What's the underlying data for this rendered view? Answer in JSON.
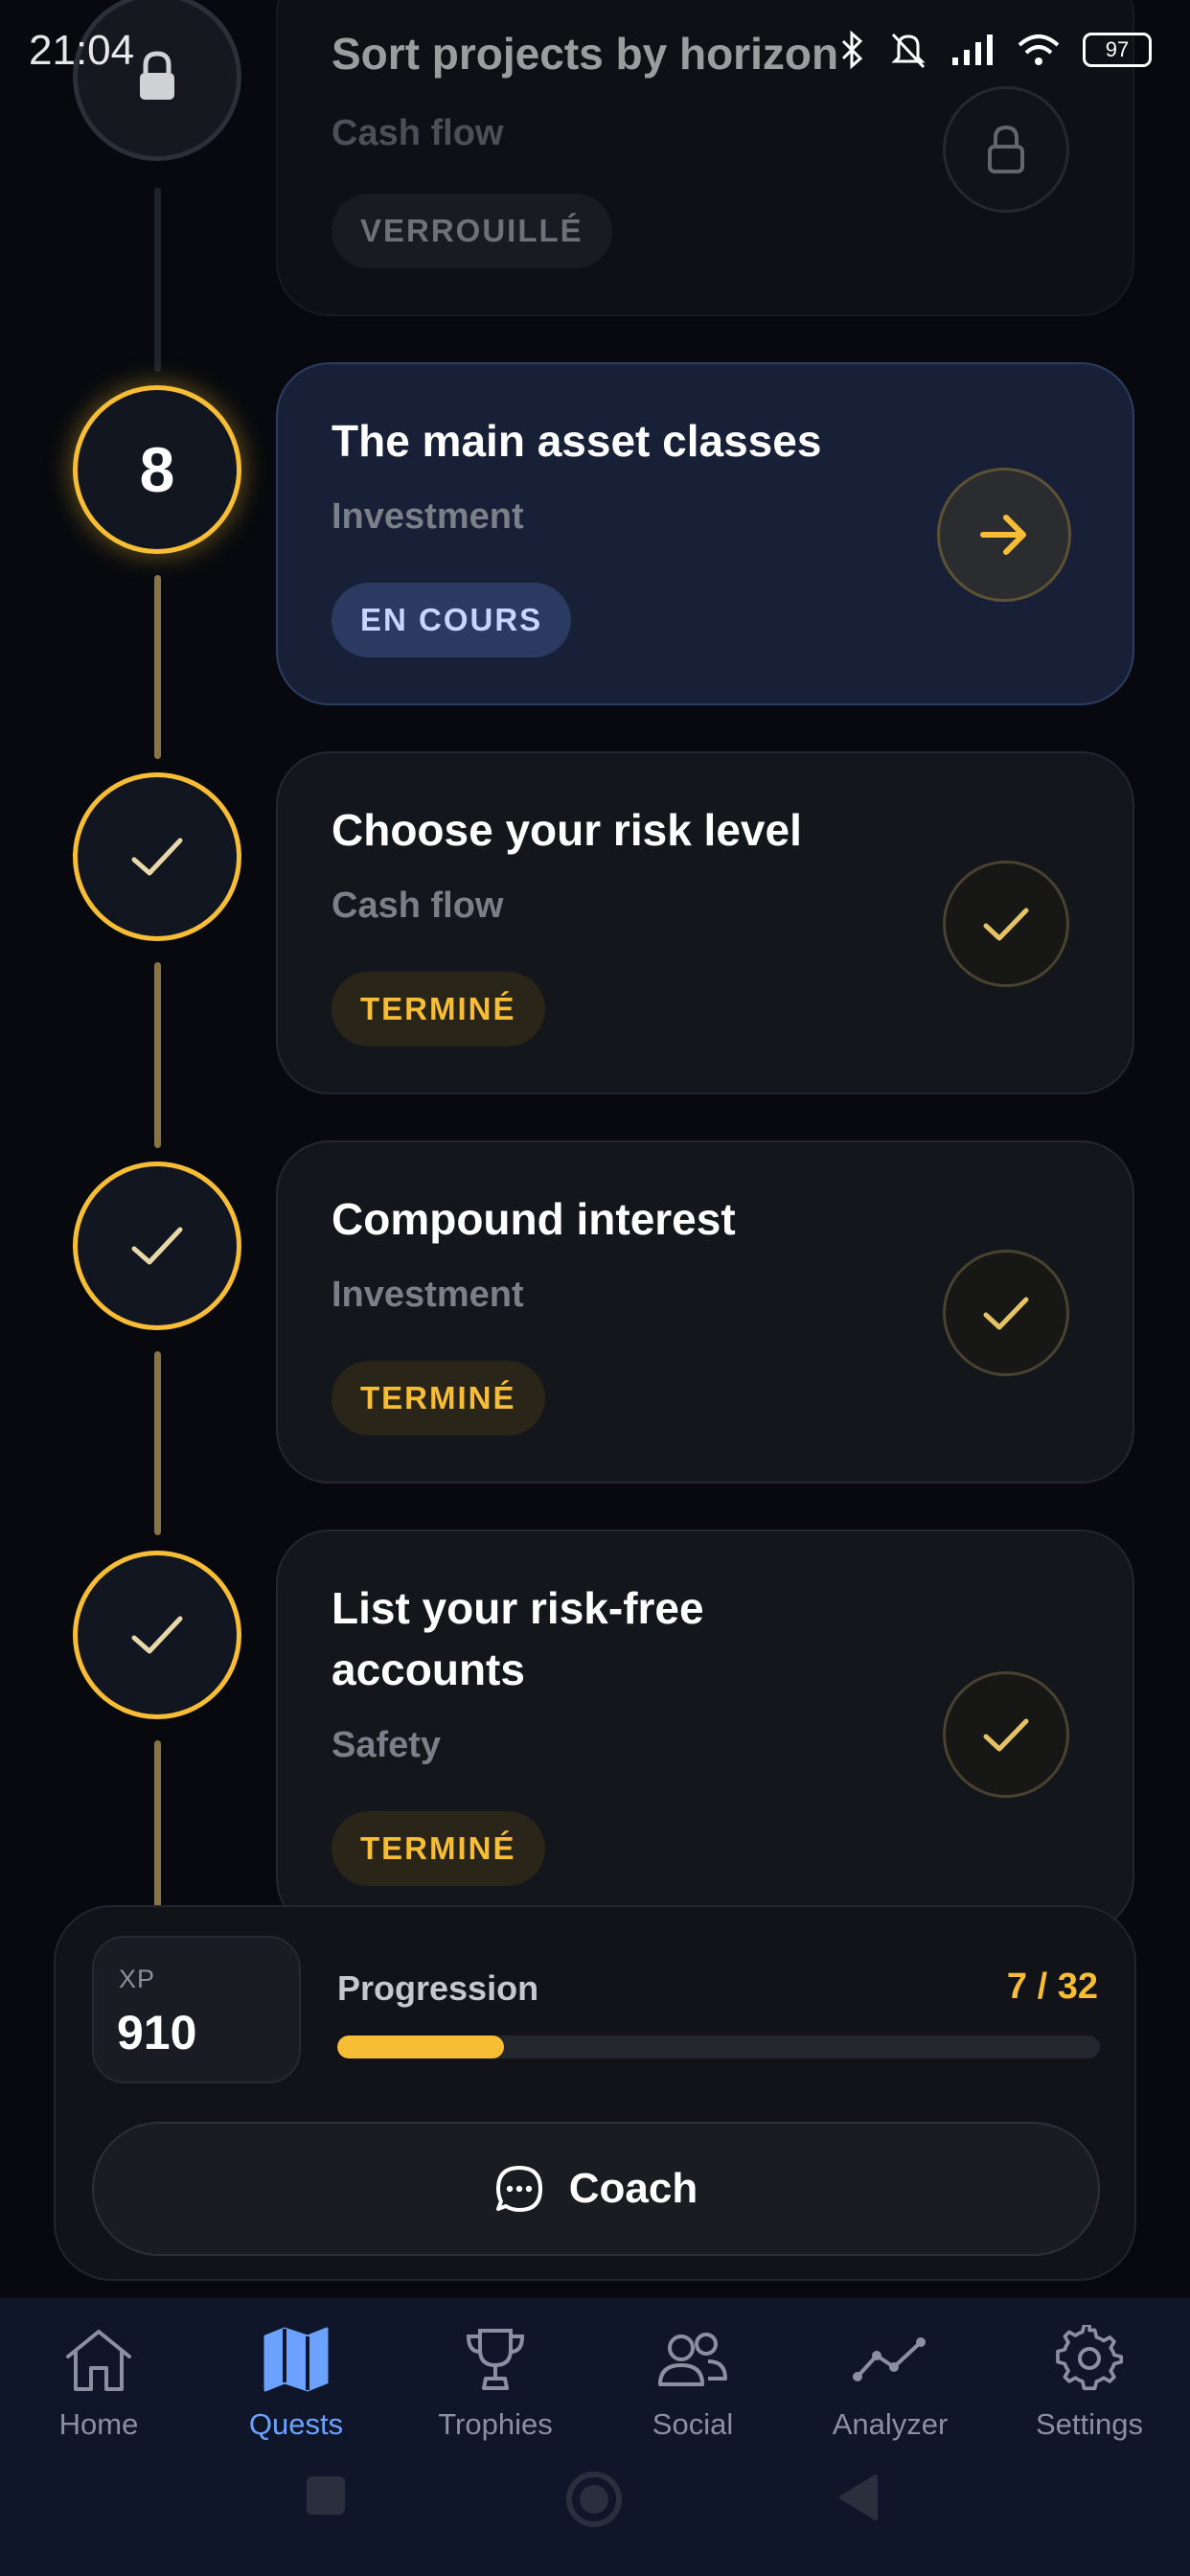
{
  "status_bar": {
    "time": "21:04",
    "battery": "97"
  },
  "quests": [
    {
      "title": "Sort projects by horizon",
      "category": "Cash flow",
      "status": "VERROUILLÉ",
      "state": "locked",
      "node_icon": "lock-icon",
      "action_icon": "lock-icon"
    },
    {
      "title": "The main asset classes",
      "category": "Investment",
      "status": "EN COURS",
      "state": "current",
      "number": "8",
      "action_icon": "arrow-right-icon"
    },
    {
      "title": "Choose your risk level",
      "category": "Cash flow",
      "status": "TERMINÉ",
      "state": "done",
      "node_icon": "check-icon",
      "action_icon": "check-icon"
    },
    {
      "title": "Compound interest",
      "category": "Investment",
      "status": "TERMINÉ",
      "state": "done",
      "node_icon": "check-icon",
      "action_icon": "check-icon"
    },
    {
      "title": "List your risk-free accounts",
      "category": "Safety",
      "status": "TERMINÉ",
      "state": "done",
      "node_icon": "check-icon",
      "action_icon": "check-icon"
    }
  ],
  "summary": {
    "xp_label": "XP",
    "xp_value": "910",
    "progress_label": "Progression",
    "progress_text": "7 / 32",
    "progress_completed": 7,
    "progress_total": 32,
    "coach_label": "Coach"
  },
  "colors": {
    "accent": "#f7bd34",
    "active_nav": "#6ca2ff",
    "background": "#07090e"
  },
  "nav": {
    "active": "Quests",
    "items": [
      {
        "label": "Home",
        "icon": "home-icon"
      },
      {
        "label": "Quests",
        "icon": "map-icon"
      },
      {
        "label": "Trophies",
        "icon": "trophy-icon"
      },
      {
        "label": "Social",
        "icon": "users-icon"
      },
      {
        "label": "Analyzer",
        "icon": "analytics-icon"
      },
      {
        "label": "Settings",
        "icon": "gear-icon"
      }
    ]
  }
}
